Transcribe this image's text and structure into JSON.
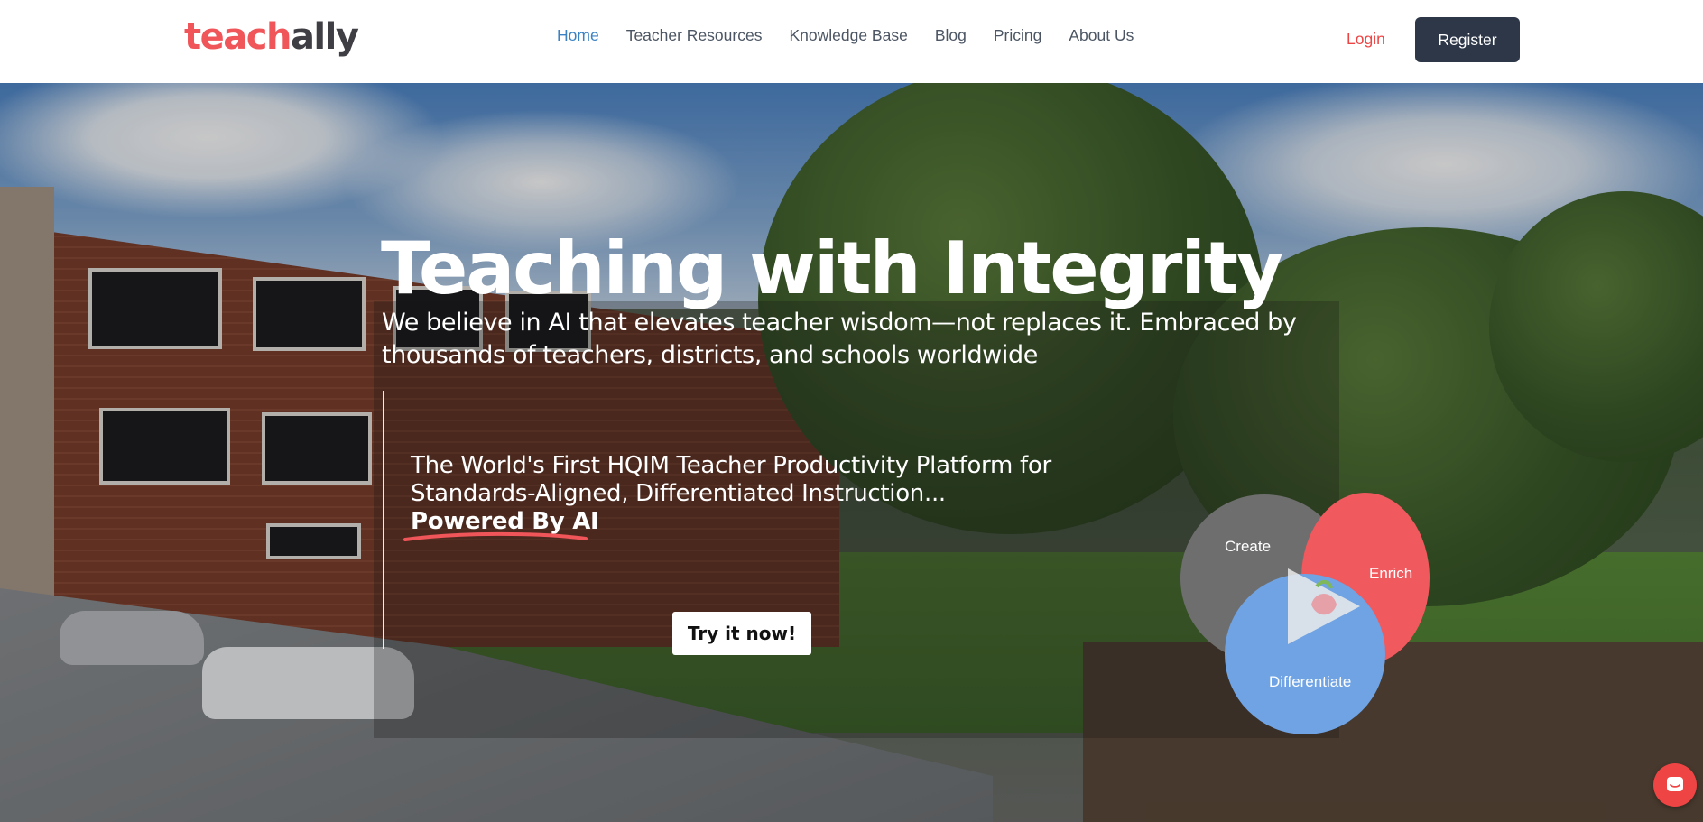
{
  "header": {
    "logo": {
      "part1": "teach",
      "part2": "ally"
    },
    "nav": [
      {
        "label": "Home",
        "active": true
      },
      {
        "label": "Teacher Resources",
        "active": false
      },
      {
        "label": "Knowledge Base",
        "active": false
      },
      {
        "label": "Blog",
        "active": false
      },
      {
        "label": "Pricing",
        "active": false
      },
      {
        "label": "About Us",
        "active": false
      }
    ],
    "login_label": "Login",
    "register_label": "Register"
  },
  "hero": {
    "headline": "Teaching with Integrity",
    "subheadline": "We believe in AI that elevates teacher wisdom—not replaces it. Embraced by thousands of teachers, districts, and schools worldwide",
    "platform_text": "The World's First HQIM Teacher Productivity Platform for Standards-Aligned, Differentiated Instruction...",
    "powered_text": "Powered By AI",
    "cta_label": "Try it now!"
  },
  "venn": {
    "create": "Create",
    "enrich": "Enrich",
    "differentiate": "Differentiate"
  },
  "colors": {
    "brand_red": "#f0555a",
    "register_bg": "#2d3748",
    "nav_active": "#3b82c4",
    "create_gray": "#6e6e6e",
    "enrich_red": "#f0595d",
    "differentiate_blue": "#6fa3e4"
  },
  "icons": {
    "play": "play-icon",
    "chat": "chat-icon"
  }
}
